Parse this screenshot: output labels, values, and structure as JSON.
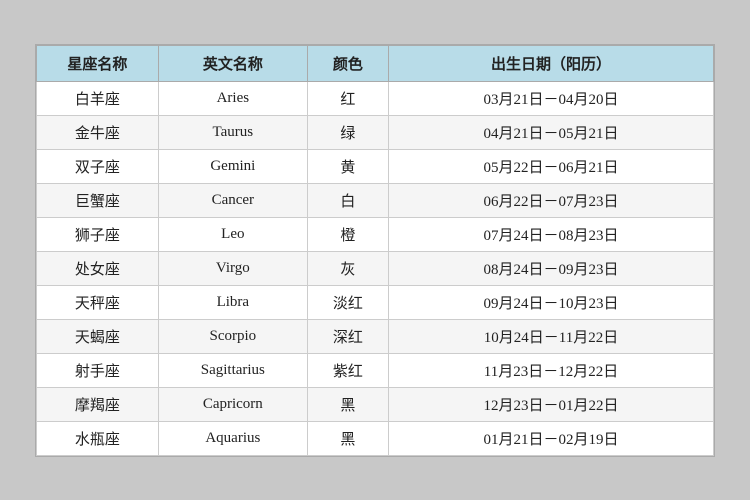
{
  "table": {
    "headers": [
      "星座名称",
      "英文名称",
      "颜色",
      "出生日期（阳历）"
    ],
    "rows": [
      {
        "chinese": "白羊座",
        "english": "Aries",
        "color": "红",
        "dates": "03月21日－04月20日"
      },
      {
        "chinese": "金牛座",
        "english": "Taurus",
        "color": "绿",
        "dates": "04月21日－05月21日"
      },
      {
        "chinese": "双子座",
        "english": "Gemini",
        "color": "黄",
        "dates": "05月22日－06月21日"
      },
      {
        "chinese": "巨蟹座",
        "english": "Cancer",
        "color": "白",
        "dates": "06月22日－07月23日"
      },
      {
        "chinese": "狮子座",
        "english": "Leo",
        "color": "橙",
        "dates": "07月24日－08月23日"
      },
      {
        "chinese": "处女座",
        "english": "Virgo",
        "color": "灰",
        "dates": "08月24日－09月23日"
      },
      {
        "chinese": "天秤座",
        "english": "Libra",
        "color": "淡红",
        "dates": "09月24日－10月23日"
      },
      {
        "chinese": "天蝎座",
        "english": "Scorpio",
        "color": "深红",
        "dates": "10月24日－11月22日"
      },
      {
        "chinese": "射手座",
        "english": "Sagittarius",
        "color": "紫红",
        "dates": "11月23日－12月22日"
      },
      {
        "chinese": "摩羯座",
        "english": "Capricorn",
        "color": "黑",
        "dates": "12月23日－01月22日"
      },
      {
        "chinese": "水瓶座",
        "english": "Aquarius",
        "color": "黑",
        "dates": "01月21日－02月19日"
      }
    ]
  }
}
